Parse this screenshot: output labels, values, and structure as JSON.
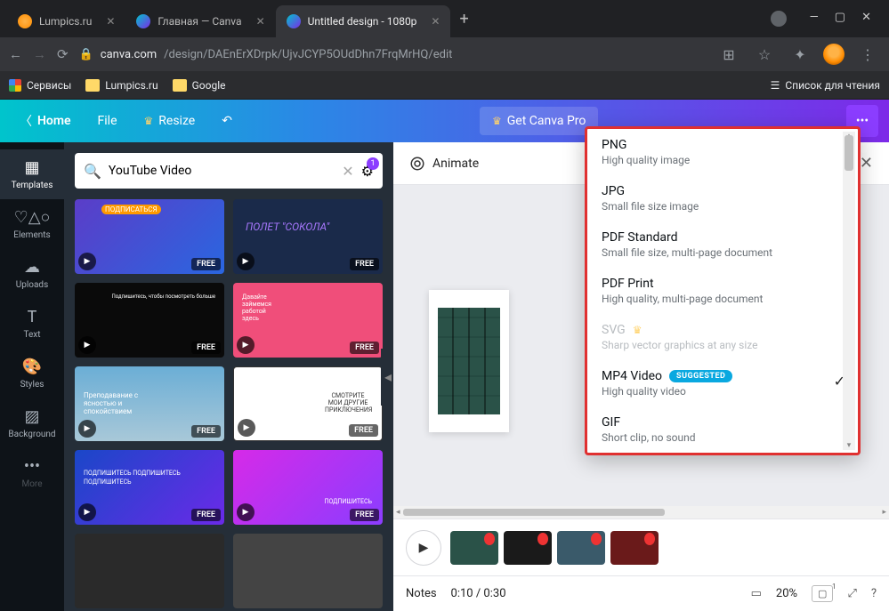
{
  "browser": {
    "tabs": [
      {
        "title": "Lumpics.ru"
      },
      {
        "title": "Главная — Canva"
      },
      {
        "title": "Untitled design - 1080p"
      }
    ],
    "url_domain": "canva.com",
    "url_path": "/design/DAEnErXDrpk/UjvJCYP5OUdDhn7FrqMrHQ/edit",
    "bookmarks": {
      "apps": "Сервисы",
      "items": [
        "Lumpics.ru",
        "Google"
      ],
      "reading_list": "Список для чтения"
    }
  },
  "canva": {
    "home": "Home",
    "file": "File",
    "resize": "Resize",
    "get_pro": "Get Canva Pro",
    "rail": {
      "templates": "Templates",
      "elements": "Elements",
      "uploads": "Uploads",
      "text": "Text",
      "styles": "Styles",
      "background": "Background",
      "more": "More"
    },
    "search_value": "YouTube Video",
    "free_label": "FREE",
    "animate": "Animate",
    "notes": "Notes",
    "time": "0:10 / 0:30",
    "zoom": "20%",
    "templates_text": {
      "t1": "ПОДПИСАТЬСЯ",
      "t2": "ПОЛЕТ \"СОКОЛА\"",
      "t3": "Подпишитесь, чтобы посмотреть больше",
      "t4": "Давайте займемся работой здесь",
      "t5": "Преподавание с ясностью и спокойствием",
      "t6": "СМОТРИТЕ МОИ ДРУГИЕ ПРИКЛЮЧЕНИЯ",
      "t7": "ПОДПИШИТЕСЬ ПОДПИШИТЕСЬ ПОДПИШИТЕСЬ",
      "t8": "ПОДПИШИТЕСЬ"
    }
  },
  "dropdown": {
    "items": [
      {
        "title": "PNG",
        "sub": "High quality image"
      },
      {
        "title": "JPG",
        "sub": "Small file size image"
      },
      {
        "title": "PDF Standard",
        "sub": "Small file size, multi-page document"
      },
      {
        "title": "PDF Print",
        "sub": "High quality, multi-page document"
      },
      {
        "title": "SVG",
        "sub": "Sharp vector graphics at any size",
        "pro": true
      },
      {
        "title": "MP4 Video",
        "sub": "High quality video",
        "suggested": "SUGGESTED",
        "selected": true
      },
      {
        "title": "GIF",
        "sub": "Short clip, no sound"
      }
    ]
  }
}
